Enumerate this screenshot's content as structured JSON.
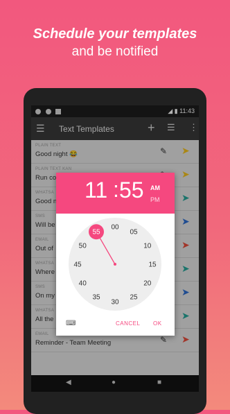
{
  "headline": {
    "line1": "Schedule your templates",
    "line2": "and be notified"
  },
  "statusbar": {
    "time": "11:43"
  },
  "toolbar": {
    "title": "Text Templates",
    "menu_icon": "hamburger-menu-icon",
    "add_icon": "plus-icon",
    "sort_icon": "sort-icon",
    "more_icon": "more-vert-icon"
  },
  "templates": [
    {
      "type": "PLAIN TEXT",
      "text": "Good night 😂",
      "color": "#f4c21f"
    },
    {
      "type": "PLAIN TEXT Kan",
      "text": "Run co",
      "color": "#f4c21f"
    },
    {
      "type": "WHATSA",
      "text": "Good n",
      "color": "#26a69a"
    },
    {
      "type": "SMS",
      "text": "Will be",
      "color": "#2f6fd0"
    },
    {
      "type": "EMAIL",
      "text": "Out of",
      "color": "#e74c3c"
    },
    {
      "type": "WHATSA",
      "text": "Where",
      "color": "#26a69a"
    },
    {
      "type": "SMS",
      "text": "On my",
      "color": "#2f6fd0"
    },
    {
      "type": "WHATSA",
      "text": "All the",
      "color": "#26a69a"
    },
    {
      "type": "EMAIL",
      "text": "Reminder - Team Meeting",
      "color": "#e74c3c"
    }
  ],
  "dialog": {
    "hour": "11",
    "separator": ":",
    "minute": "55",
    "am": "AM",
    "pm": "PM",
    "selected_period": "AM",
    "clock_numbers": [
      "00",
      "05",
      "10",
      "15",
      "20",
      "25",
      "30",
      "35",
      "40",
      "45",
      "50",
      "55"
    ],
    "selected_minute": "55",
    "cancel": "CANCEL",
    "ok": "OK",
    "keyboard_icon": "keyboard-icon",
    "accent": "#f5487f"
  },
  "nav": {
    "back_icon": "back-icon",
    "home_icon": "home-icon",
    "recents_icon": "recents-icon"
  }
}
